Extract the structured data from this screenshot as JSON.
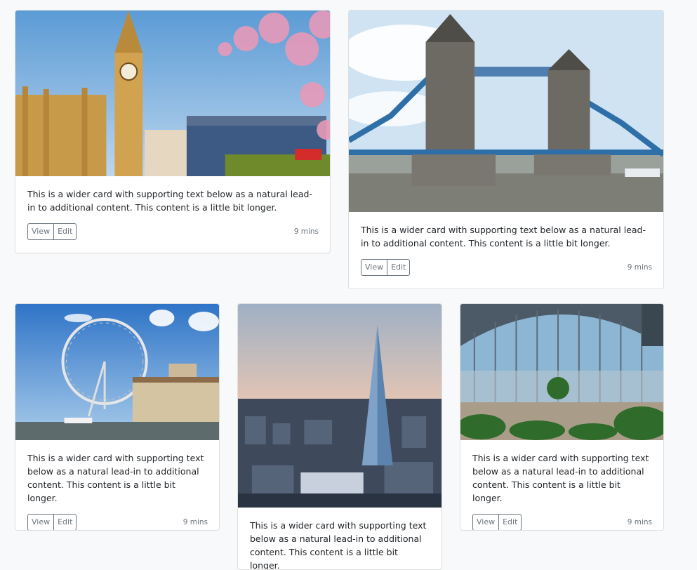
{
  "card_text": "This is a wider card with supporting text below as a natural lead-in to additional content. This content is a little bit longer.",
  "view_label": "View",
  "edit_label": "Edit",
  "time_label": "9 mins",
  "cards": [
    {
      "image": "Big Ben and Westminster with cherry blossoms"
    },
    {
      "image": "Tower Bridge over the River Thames"
    },
    {
      "image": "London Eye and County Hall"
    },
    {
      "image": "The Shard skyline at sunset"
    },
    {
      "image": "Sky Garden glass dome interior"
    }
  ]
}
